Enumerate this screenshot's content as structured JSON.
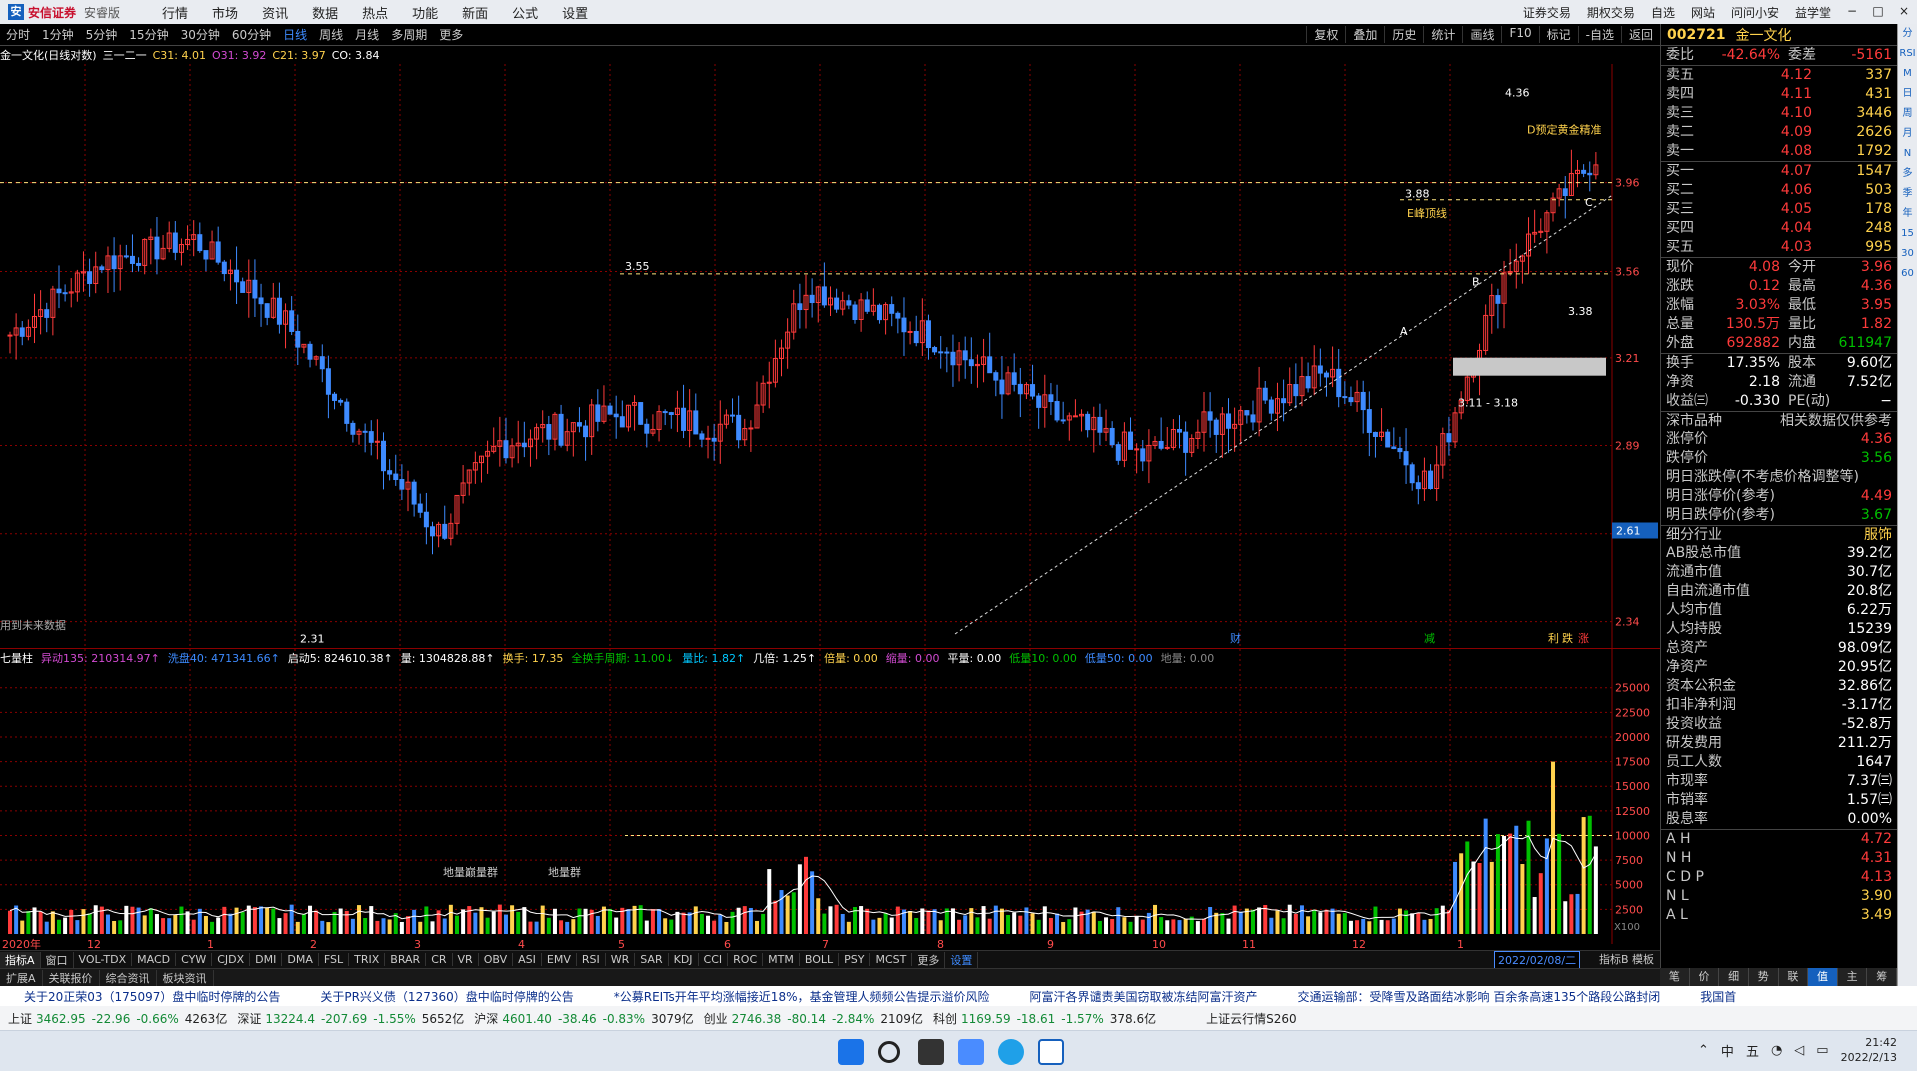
{
  "menubar": {
    "logo": "安信证券",
    "version": "安睿版",
    "items": [
      "行情",
      "市场",
      "资讯",
      "数据",
      "热点",
      "功能",
      "新面",
      "公式",
      "设置"
    ],
    "right": [
      "证券交易",
      "期权交易",
      "自选",
      "网站",
      "问问小安",
      "益学堂"
    ],
    "window_controls": [
      "−",
      "□",
      "×"
    ]
  },
  "periods": [
    "分时",
    "1分钟",
    "5分钟",
    "15分钟",
    "30分钟",
    "60分钟",
    "日线",
    "周线",
    "月线",
    "多周期",
    "更多"
  ],
  "active_period": "日线",
  "toolbar_right": [
    "复权",
    "叠加",
    "历史",
    "统计",
    "画线",
    "F10",
    "标记",
    "-自选",
    "返回"
  ],
  "infoline": {
    "name": "金一文化(日线对数)",
    "indicator": "三一二一",
    "c31": "C31: 4.01",
    "o31": "O31: 3.92",
    "c21": "C21: 3.97",
    "co": "CO: 3.84"
  },
  "chart_data": {
    "type": "candlestick",
    "y_ticks": [
      "3.96",
      "3.56",
      "3.21",
      "2.89",
      "2.60",
      "2.34"
    ],
    "current_price_label": "2.61",
    "annotations": [
      "4.36",
      "3.88",
      "3.55",
      "2.31",
      "3.38",
      "3.11 - 3.18",
      "D预定黄金精准",
      "E峰顶线",
      "A",
      "B",
      "C",
      "用到未来数据"
    ],
    "event_marks": [
      "财",
      "减",
      "利",
      "跌",
      "涨"
    ],
    "x_ticks": [
      "2020年",
      "12",
      "1",
      "2",
      "3",
      "4",
      "5",
      "6",
      "7",
      "8",
      "9",
      "10",
      "11",
      "12",
      "1",
      "2022/02/08/二"
    ],
    "volume_y_ticks": [
      "25000",
      "22500",
      "20000",
      "17500",
      "15000",
      "12500",
      "10000",
      "7500",
      "5000",
      "2500"
    ],
    "volume_unit": "X100",
    "volume_annotations": [
      "地量巅量群",
      "地量群"
    ]
  },
  "volinfo": {
    "title": "七量柱",
    "yd": "异动135: 210314.97↑",
    "xl": "洗盘40: 471341.66↑",
    "qd": "启动5: 824610.38↑",
    "l": "量: 1304828.88↑",
    "hs": "换手: 17.35",
    "qhs": "全换手周期: 11.00↓",
    "lb": "量比: 1.82↑",
    "jb": "几倍: 1.25↑",
    "bl": "倍量: 0.00",
    "sl": "缩量: 0.00",
    "pl": "平量: 0.00",
    "dl1": "低量10: 0.00",
    "dl2": "低量50: 0.00",
    "dl3": "地量: 0.00"
  },
  "indicator_tabs": [
    "指标A",
    "窗口",
    "VOL-TDX",
    "MACD",
    "CYW",
    "CJDX",
    "DMI",
    "DMA",
    "FSL",
    "TRIX",
    "BRAR",
    "CR",
    "VR",
    "OBV",
    "ASI",
    "EMV",
    "RSI",
    "WR",
    "SAR",
    "KDJ",
    "CCI",
    "ROC",
    "MTM",
    "BOLL",
    "PSY",
    "MCST",
    "更多",
    "设置"
  ],
  "tabs_right": "指标B 模板",
  "date_badge": "2022/02/08/二",
  "tabs2": [
    "扩展A",
    "关联报价",
    "综合资讯",
    "板块资讯"
  ],
  "tabs2_right": "图文F10 侧边栏 《",
  "news": [
    "关于20正荣03（175097）盘中临时停牌的公告",
    "关于PR兴义债（127360）盘中临时停牌的公告",
    "*公募REITs开年平均涨幅接近18%，基金管理人频频公告提示溢价风险",
    "阿富汗各界谴责美国窃取被冻结阿富汗资产",
    "交通运输部：受降雪及路面结冰影响 百余条高速135个路段公路封闭",
    "我国首"
  ],
  "indices": [
    {
      "name": "上证",
      "val": "3462.95",
      "chg": "-22.96",
      "pct": "-0.66%",
      "amt": "4263亿"
    },
    {
      "name": "深证",
      "val": "13224.4",
      "chg": "-207.69",
      "pct": "-1.55%",
      "amt": "5652亿"
    },
    {
      "name": "沪深",
      "val": "4601.40",
      "chg": "-38.46",
      "pct": "-0.83%",
      "amt": "3079亿"
    },
    {
      "name": "创业",
      "val": "2746.38",
      "chg": "-80.14",
      "pct": "-2.84%",
      "amt": "2109亿"
    },
    {
      "name": "科创",
      "val": "1169.59",
      "chg": "-18.61",
      "pct": "-1.57%",
      "amt": "378.6亿"
    }
  ],
  "cloud": "上证云行情S260",
  "quote": {
    "code": "002721",
    "name": "金一文化",
    "wb": {
      "l1": "委比",
      "v1": "-42.64%",
      "l2": "委差",
      "v2": "-5161"
    },
    "sell": [
      [
        "卖五",
        "4.12",
        "337"
      ],
      [
        "卖四",
        "4.11",
        "431"
      ],
      [
        "卖三",
        "4.10",
        "3446"
      ],
      [
        "卖二",
        "4.09",
        "2626"
      ],
      [
        "卖一",
        "4.08",
        "1792"
      ]
    ],
    "buy": [
      [
        "买一",
        "4.07",
        "1547"
      ],
      [
        "买二",
        "4.06",
        "503"
      ],
      [
        "买三",
        "4.05",
        "178"
      ],
      [
        "买四",
        "4.04",
        "248"
      ],
      [
        "买五",
        "4.03",
        "995"
      ]
    ],
    "stats": [
      [
        "现价",
        "4.08",
        "今开",
        "3.96"
      ],
      [
        "涨跌",
        "0.12",
        "最高",
        "4.36"
      ],
      [
        "涨幅",
        "3.03%",
        "最低",
        "3.95"
      ],
      [
        "总量",
        "130.5万",
        "量比",
        "1.82"
      ],
      [
        "外盘",
        "692882",
        "内盘",
        "611947"
      ]
    ],
    "stats2": [
      [
        "换手",
        "17.35%",
        "股本",
        "9.60亿"
      ],
      [
        "净资",
        "2.18",
        "流通",
        "7.52亿"
      ],
      [
        "收益㈢",
        "-0.330",
        "PE(动)",
        "−"
      ]
    ],
    "market": {
      "l": "深市品种",
      "r": "相关数据仅供参考"
    },
    "limits": [
      [
        "涨停价",
        "4.36"
      ],
      [
        "跌停价",
        "3.56"
      ]
    ],
    "next": [
      [
        "明日涨跌停(不考虑价格调整等)",
        ""
      ],
      [
        "明日涨停价(参考)",
        "4.49"
      ],
      [
        "明日跌停价(参考)",
        "3.67"
      ]
    ],
    "industry": {
      "k": "细分行业",
      "v": "服饰"
    },
    "fund": [
      [
        "AB股总市值",
        "39.2亿"
      ],
      [
        "流通市值",
        "30.7亿"
      ],
      [
        "自由流通市值",
        "20.8亿"
      ],
      [
        "人均市值",
        "6.22万"
      ],
      [
        "人均持股",
        "15239"
      ],
      [
        "总资产",
        "98.09亿"
      ],
      [
        "净资产",
        "20.95亿"
      ],
      [
        "资本公积金",
        "32.86亿"
      ],
      [
        "扣非净利润",
        "-3.17亿"
      ],
      [
        "投资收益",
        "-52.8万"
      ],
      [
        "研发费用",
        "211.2万"
      ],
      [
        "员工人数",
        "1647"
      ],
      [
        "市现率",
        "7.37㈢"
      ],
      [
        "市销率",
        "1.57㈢"
      ],
      [
        "股息率",
        "0.00%"
      ]
    ],
    "ah": [
      [
        "A H",
        "4.72"
      ],
      [
        "N H",
        "4.31"
      ],
      [
        "C D P",
        "4.13"
      ],
      [
        "N L",
        "3.90"
      ],
      [
        "A L",
        "3.49"
      ]
    ]
  },
  "side_icons": [
    "分",
    "RSI",
    "M",
    "日",
    "周",
    "月",
    "N",
    "多",
    "季",
    "年",
    "15",
    "30",
    "60"
  ],
  "bottom_tabs": [
    "笔",
    "价",
    "细",
    "势",
    "联",
    "值",
    "主",
    "筹"
  ],
  "clock": {
    "time": "21:42",
    "date": "2022/2/13"
  },
  "ime": [
    "中",
    "五"
  ],
  "colors": {
    "up": "#ff3b3b",
    "down": "#3e8bff",
    "grid": "#8b0000",
    "yellow": "#ffd24d"
  }
}
